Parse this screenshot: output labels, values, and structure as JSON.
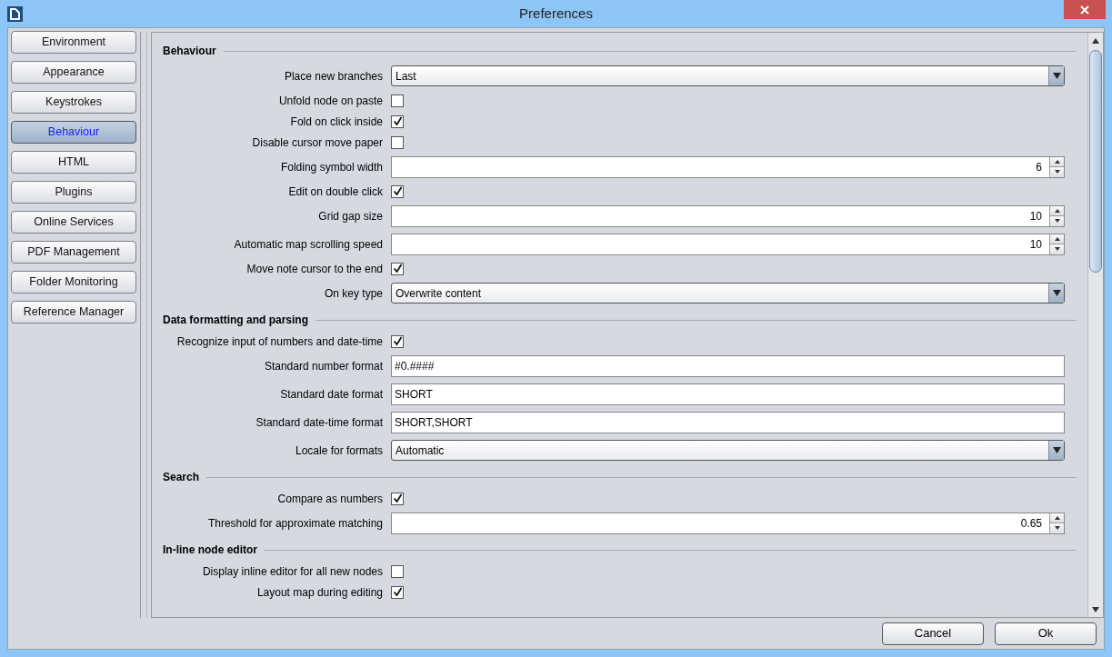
{
  "window": {
    "title": "Preferences"
  },
  "sidebar": {
    "items": [
      {
        "label": "Environment",
        "selected": false
      },
      {
        "label": "Appearance",
        "selected": false
      },
      {
        "label": "Keystrokes",
        "selected": false
      },
      {
        "label": "Behaviour",
        "selected": true
      },
      {
        "label": "HTML",
        "selected": false
      },
      {
        "label": "Plugins",
        "selected": false
      },
      {
        "label": "Online Services",
        "selected": false
      },
      {
        "label": "PDF Management",
        "selected": false
      },
      {
        "label": "Folder Monitoring",
        "selected": false
      },
      {
        "label": "Reference Manager",
        "selected": false
      }
    ]
  },
  "sections": [
    {
      "title": "Behaviour",
      "rows": [
        {
          "kind": "combo",
          "label": "Place new branches",
          "value": "Last"
        },
        {
          "kind": "checkbox",
          "label": "Unfold node on paste",
          "checked": false
        },
        {
          "kind": "checkbox",
          "label": "Fold on click inside",
          "checked": true
        },
        {
          "kind": "checkbox",
          "label": "Disable cursor move paper",
          "checked": false
        },
        {
          "kind": "spinner",
          "label": "Folding symbol width",
          "value": "6"
        },
        {
          "kind": "checkbox",
          "label": "Edit on double click",
          "checked": true
        },
        {
          "kind": "spinner",
          "label": "Grid gap size",
          "value": "10"
        },
        {
          "kind": "spinner",
          "label": "Automatic map scrolling speed",
          "value": "10"
        },
        {
          "kind": "checkbox",
          "label": "Move note cursor to the end",
          "checked": true
        },
        {
          "kind": "combo",
          "label": "On key type",
          "value": "Overwrite content"
        }
      ]
    },
    {
      "title": "Data formatting and parsing",
      "rows": [
        {
          "kind": "checkbox",
          "label": "Recognize input of numbers and date-time",
          "checked": true
        },
        {
          "kind": "text",
          "label": "Standard number format",
          "value": "#0.####"
        },
        {
          "kind": "text",
          "label": "Standard date format",
          "value": "SHORT"
        },
        {
          "kind": "text",
          "label": "Standard date-time format",
          "value": "SHORT,SHORT"
        },
        {
          "kind": "combo",
          "label": "Locale for formats",
          "value": "Automatic"
        }
      ]
    },
    {
      "title": "Search",
      "rows": [
        {
          "kind": "checkbox",
          "label": "Compare as numbers",
          "checked": true
        },
        {
          "kind": "spinner",
          "label": "Threshold for approximate matching",
          "value": "0.65"
        }
      ]
    },
    {
      "title": "In-line node editor",
      "rows": [
        {
          "kind": "checkbox",
          "label": "Display inline editor for all new nodes",
          "checked": false
        },
        {
          "kind": "checkbox",
          "label": "Layout map during editing",
          "checked": true
        }
      ]
    }
  ],
  "buttons": [
    {
      "label": "Cancel"
    },
    {
      "label": "Ok"
    }
  ]
}
